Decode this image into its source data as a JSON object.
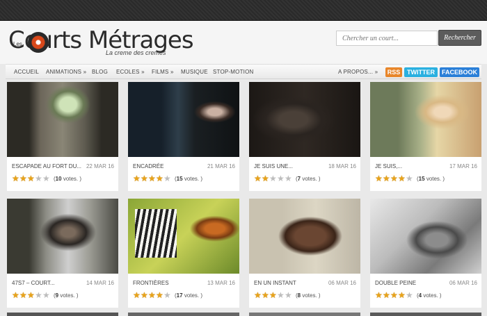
{
  "header": {
    "logo_big": "Courts Métrages",
    "logo_small": "Les",
    "tagline": "La creme des cremes",
    "search_placeholder": "Chercher un court...",
    "search_button": "Rechercher"
  },
  "nav": {
    "items": [
      "ACCUEIL",
      "ANIMATIONS »",
      "BLOG",
      "ECOLES »",
      "FILMS »",
      "MUSIQUE",
      "STOP-MOTION"
    ],
    "about": "A PROPOS... »",
    "rss": "RSS",
    "twitter": "TWITTER",
    "facebook": "FACEBOOK"
  },
  "films": [
    {
      "title": "ESCAPADE AU FORT DU...",
      "date": "22 MAR 16",
      "rating": 2.5,
      "votes": "10",
      "votes_suffix": "votes. )"
    },
    {
      "title": "ENCADRÉE",
      "date": "21 MAR 16",
      "rating": 3.5,
      "votes": "15",
      "votes_suffix": "votes. )"
    },
    {
      "title": "JE SUIS UNE...",
      "date": "18 MAR 16",
      "rating": 1.5,
      "votes": "7",
      "votes_suffix": "votes. )"
    },
    {
      "title": "JE SUIS,...",
      "date": "17 MAR 16",
      "rating": 3.5,
      "votes": "15",
      "votes_suffix": "votes. )"
    },
    {
      "title": "47S7 – COURT...",
      "date": "14 MAR 16",
      "rating": 3,
      "votes": "9",
      "votes_suffix": "votes. )"
    },
    {
      "title": "FRONTIÈRES",
      "date": "13 MAR 16",
      "rating": 4,
      "votes": "17",
      "votes_suffix": "votes. )"
    },
    {
      "title": "EN UN INSTANT",
      "date": "06 MAR 16",
      "rating": 2.5,
      "votes": "8",
      "votes_suffix": "votes. )"
    },
    {
      "title": "DOUBLE PEINE",
      "date": "06 MAR 16",
      "rating": 3.5,
      "votes": "4",
      "votes_suffix": "votes. )"
    }
  ],
  "colors": {
    "rss": "#e8862a",
    "twitter": "#2ab0e0",
    "facebook": "#2a7fd8",
    "star": "#e8a31a"
  }
}
